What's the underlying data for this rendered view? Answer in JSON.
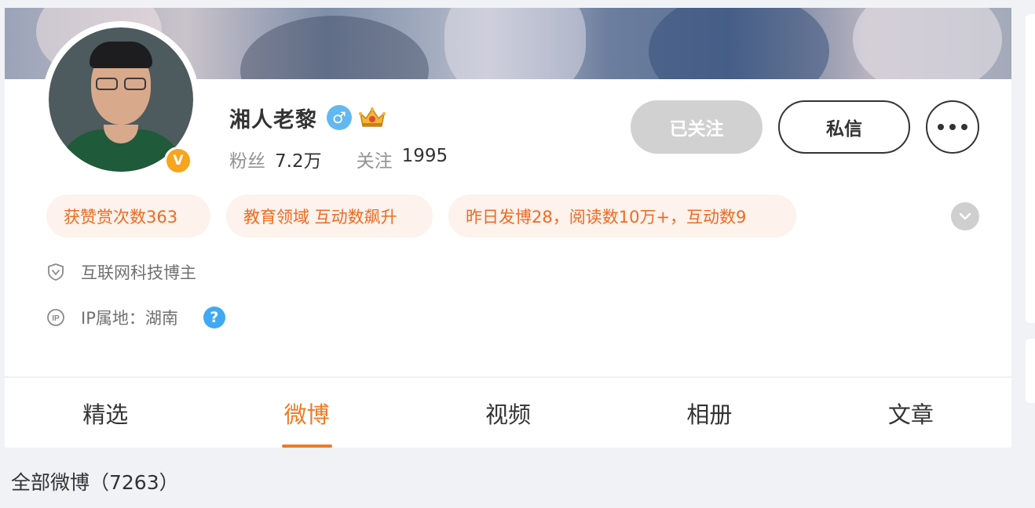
{
  "profile": {
    "name": "湘人老黎",
    "verify_badge": "V",
    "gender_symbol": "♂",
    "stats": {
      "fans_label": "粉丝",
      "fans_value": "7.2万",
      "follow_label": "关注",
      "follow_value": "1995"
    }
  },
  "actions": {
    "followed_label": "已关注",
    "message_label": "私信"
  },
  "tags": [
    "获赞赏次数363",
    "教育领域 互动数飙升",
    "昨日发博28，阅读数10万+，互动数9"
  ],
  "info": {
    "category": "互联网科技博主",
    "ip_location": "IP属地：湖南",
    "help_symbol": "?"
  },
  "tabs": [
    {
      "label": "精选"
    },
    {
      "label": "微博"
    },
    {
      "label": "视频"
    },
    {
      "label": "相册"
    },
    {
      "label": "文章"
    }
  ],
  "active_tab": "微博",
  "feed": {
    "all_weibo_label": "全部微博（7263）"
  },
  "colors": {
    "accent": "#ef7b22",
    "tag_text": "#ef6a21",
    "tag_bg": "#fdf2ec",
    "verify": "#f7a51f",
    "gender": "#62b8f0",
    "help": "#3fa9f5",
    "followed_bg": "#d1d1d1"
  }
}
